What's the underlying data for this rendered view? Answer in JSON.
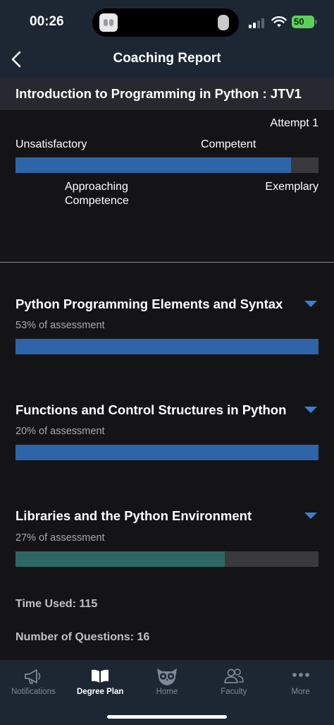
{
  "status_bar": {
    "time": "00:26",
    "battery": "50"
  },
  "nav": {
    "title": "Coaching Report"
  },
  "course": {
    "title": "Introduction to Programming in Python : JTV1"
  },
  "overall": {
    "attempt": "Attempt 1",
    "labels": {
      "unsatisfactory": "Unsatisfactory",
      "competent": "Competent",
      "approaching": "Approaching Competence",
      "exemplary": "Exemplary"
    },
    "progress": 0.91
  },
  "sections": [
    {
      "title": "Python Programming Elements and Syntax",
      "weight": "53% of assessment",
      "progress": 1.0,
      "color": "#2e64a8"
    },
    {
      "title": "Functions and Control Structures in Python",
      "weight": "20% of assessment",
      "progress": 1.0,
      "color": "#2e64a8"
    },
    {
      "title": "Libraries and the Python Environment",
      "weight": "27% of assessment",
      "progress": 0.69,
      "color": "#2e6663"
    }
  ],
  "stats": {
    "time_used": "Time Used: 115",
    "questions": "Number of Questions: 16"
  },
  "tabs": [
    {
      "label": "Notifications",
      "icon": "megaphone-icon",
      "active": false
    },
    {
      "label": "Degree Plan",
      "icon": "book-icon",
      "active": true
    },
    {
      "label": "Home",
      "icon": "owl-icon",
      "active": false
    },
    {
      "label": "Faculty",
      "icon": "people-icon",
      "active": false
    },
    {
      "label": "More",
      "icon": "more-dots-icon",
      "active": false
    }
  ],
  "colors": {
    "accent_blue": "#2e64a8",
    "accent_teal": "#2e6663",
    "caret_blue": "#3b7fd4",
    "header_bg": "#1d2734",
    "page_bg": "#141416"
  }
}
